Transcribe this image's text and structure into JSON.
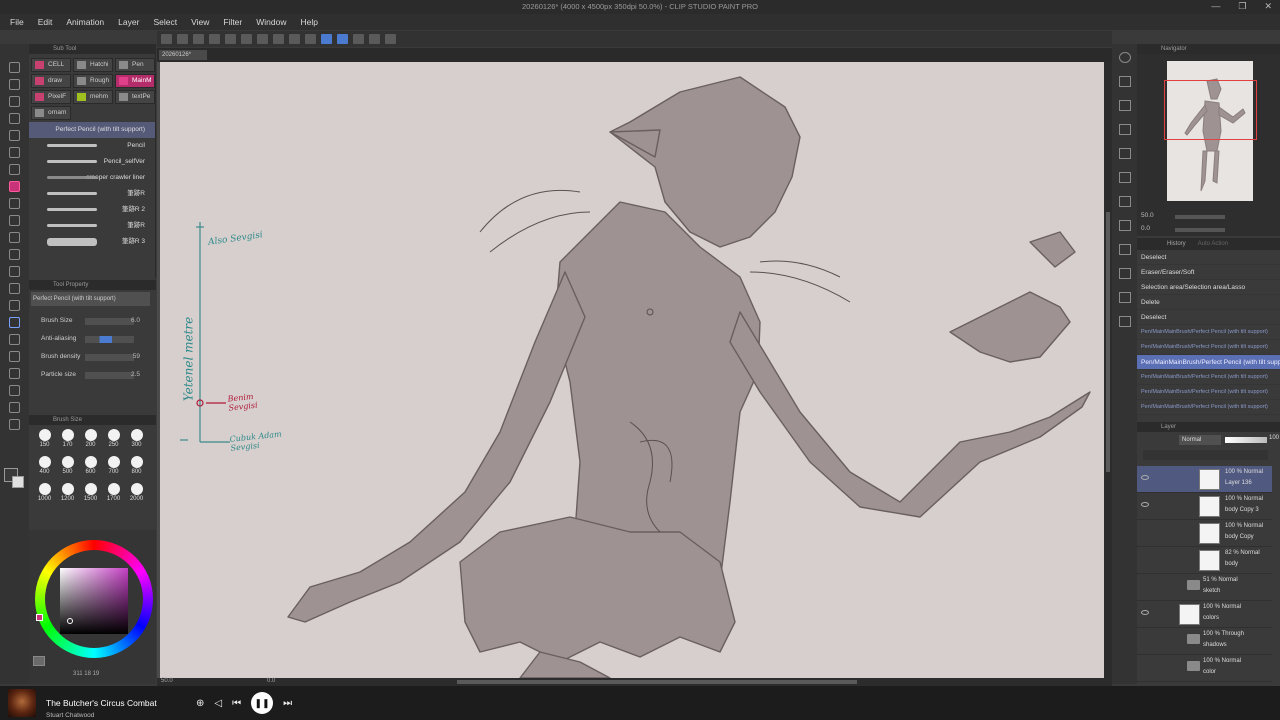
{
  "window": {
    "title": "20260126* (4000 x 4500px 350dpi 50.0%) - CLIP STUDIO PAINT PRO",
    "controls": [
      "—",
      "❐",
      "✕"
    ]
  },
  "menu": [
    "File",
    "Edit",
    "Animation",
    "Layer",
    "Select",
    "View",
    "Filter",
    "Window",
    "Help"
  ],
  "doc_tab": {
    "name": "20260126*"
  },
  "sub_tool": {
    "header": "Sub Tool",
    "groups": [
      {
        "label": "CELL",
        "color": "#c84070"
      },
      {
        "label": "Hatchi",
        "color": "#8a8a8a"
      },
      {
        "label": "Pen",
        "color": "#8a8a8a"
      },
      {
        "label": "draw",
        "color": "#c84070"
      },
      {
        "label": "Rough",
        "color": "#8a8a8a"
      },
      {
        "label": "MainM",
        "color": "#e0408a"
      },
      {
        "label": "PixelF",
        "color": "#c84070"
      },
      {
        "label": "mehm",
        "color": "#a0c020"
      },
      {
        "label": "textPe",
        "color": "#8a8a8a"
      },
      {
        "label": "ornam",
        "color": "#8a8a8a"
      }
    ],
    "brushes": [
      {
        "label": "Perfect Pencil (with tilt support)"
      },
      {
        "label": "Pencil"
      },
      {
        "label": "Pencil_selfVer"
      },
      {
        "label": "creeper crawler liner"
      },
      {
        "label": "筆跡R"
      },
      {
        "label": "筆跡R 2"
      },
      {
        "label": "筆跡R"
      },
      {
        "label": "筆跡R 3"
      }
    ]
  },
  "tool_property": {
    "header": "Tool Property",
    "tool_name": "Perfect Pencil (with tilt support)",
    "brush_size_label": "Brush Size",
    "brush_size": "6.0",
    "anti_aliasing_label": "Anti-aliasing",
    "density_label": "Brush density",
    "density": "59",
    "particle_label": "Particle size",
    "particle": "2.5"
  },
  "brush_size_panel": {
    "header": "Brush Size",
    "sizes": [
      "150",
      "170",
      "200",
      "250",
      "300",
      "400",
      "500",
      "600",
      "700",
      "800",
      "1000",
      "1200",
      "1500",
      "1700",
      "2000"
    ]
  },
  "color": {
    "main": "#c8337a",
    "sv_hue": "#c43fc4",
    "coords": "311 18 19"
  },
  "canvas": {
    "annotations": {
      "also": "Also Sevgisi",
      "scale": "Yetenel metre",
      "benim": "Benim Sevgisi",
      "cubuk": "Cubuk Adam Sevgisi"
    },
    "zoom": "50.0",
    "angle": "0.0"
  },
  "navigator": {
    "header": "Navigator",
    "zoom": "50.0",
    "angle": "0.0"
  },
  "history": {
    "tabs": [
      "History",
      "Auto Action"
    ],
    "items": [
      {
        "label": "Deselect",
        "style": "normal"
      },
      {
        "label": "Eraser/Eraser/Soft",
        "style": "normal"
      },
      {
        "label": "Selection area/Selection area/Lasso",
        "style": "normal"
      },
      {
        "label": "Delete",
        "style": "normal"
      },
      {
        "label": "Deselect",
        "style": "normal"
      },
      {
        "label": "Pen/MainMainBrush/Perfect Pencil (with tilt support)",
        "style": "dim"
      },
      {
        "label": "Pen/MainMainBrush/Perfect Pencil (with tilt support)",
        "style": "dim"
      },
      {
        "label": "Pen/MainMainBrush/Perfect Pencil (with tilt support)",
        "style": "sel"
      },
      {
        "label": "Pen/MainMainBrush/Perfect Pencil (with tilt support)",
        "style": "dim"
      },
      {
        "label": "Pen/MainMainBrush/Perfect Pencil (with tilt support)",
        "style": "dim"
      },
      {
        "label": "Pen/MainMainBrush/Perfect Pencil (with tilt support)",
        "style": "dim"
      }
    ]
  },
  "layers": {
    "header": "Layer",
    "blend_mode": "Normal",
    "opacity": "100",
    "rows": [
      {
        "mode": "100 % Normal",
        "name": "Layer 136",
        "kind": "raster",
        "visible": true,
        "selected": true
      },
      {
        "mode": "100 % Normal",
        "name": "body Copy 3",
        "kind": "raster",
        "visible": true,
        "selected": false
      },
      {
        "mode": "100 % Normal",
        "name": "body Copy",
        "kind": "raster",
        "visible": false,
        "selected": false
      },
      {
        "mode": "82 % Normal",
        "name": "body",
        "kind": "raster",
        "visible": false,
        "selected": false
      },
      {
        "mode": "51 % Normal",
        "name": "sketch",
        "kind": "folder",
        "visible": false,
        "selected": false
      },
      {
        "mode": "100 % Normal",
        "name": "colors",
        "kind": "raster",
        "visible": true,
        "selected": false
      },
      {
        "mode": "100 % Through",
        "name": "shadows",
        "kind": "folder",
        "visible": false,
        "selected": false
      },
      {
        "mode": "100 % Normal",
        "name": "color",
        "kind": "folder",
        "visible": false,
        "selected": false
      }
    ]
  },
  "media": {
    "title": "The Butcher's Circus Combat",
    "artist": "Stuart Chatwood",
    "prev": "⏮",
    "play": "❚❚",
    "next": "⏭",
    "rewind": "◁",
    "share": "⊕"
  }
}
